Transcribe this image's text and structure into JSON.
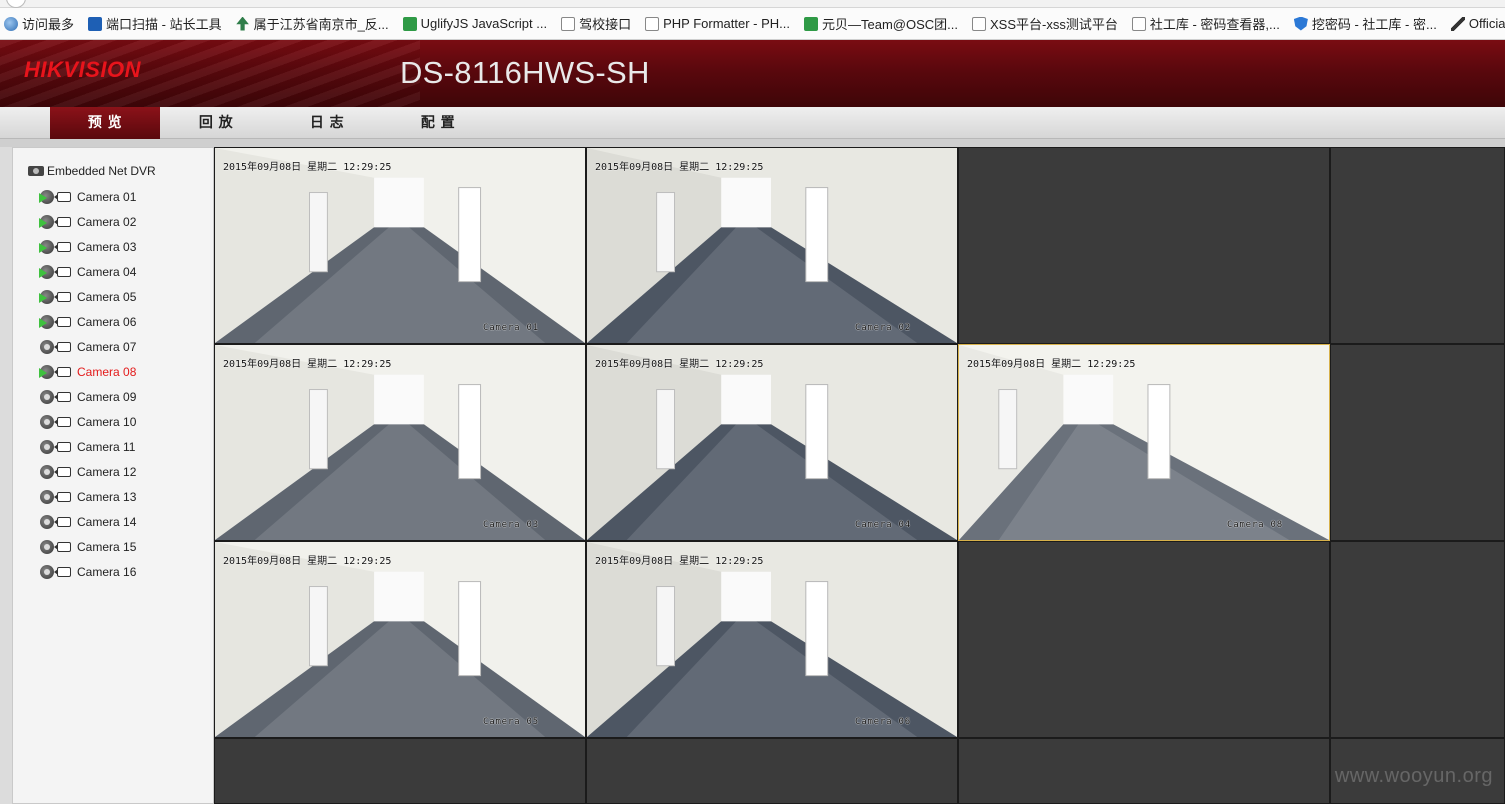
{
  "bookmarks": [
    {
      "label": "访问最多",
      "icon": "globe-icon"
    },
    {
      "label": "端口扫描 - 站长工具",
      "icon": "page-icon"
    },
    {
      "label": "属于江苏省南京市_反...",
      "icon": "tree-icon"
    },
    {
      "label": "UglifyJS JavaScript ...",
      "icon": "green-icon"
    },
    {
      "label": "驾校接口",
      "icon": "page-icon"
    },
    {
      "label": "PHP Formatter - PH...",
      "icon": "page-icon"
    },
    {
      "label": "元贝—Team@OSC团...",
      "icon": "green-icon"
    },
    {
      "label": "XSS平台-xss测试平台",
      "icon": "page-icon"
    },
    {
      "label": "社工库 - 密码查看器,...",
      "icon": "page-icon"
    },
    {
      "label": "挖密码 - 社工库 - 密...",
      "icon": "shield-icon"
    },
    {
      "label": "Official Kali Linux Do",
      "icon": "sword-icon"
    }
  ],
  "header": {
    "logo_text": "HIKVISION",
    "model": "DS-8116HWS-SH",
    "accent": "#e8141c"
  },
  "nav": {
    "items": [
      {
        "label": "预 览",
        "active": true
      },
      {
        "label": "回 放",
        "active": false
      },
      {
        "label": "日 志",
        "active": false
      },
      {
        "label": "配 置",
        "active": false
      }
    ]
  },
  "device_tree": {
    "root_label": "Embedded Net DVR",
    "selected": "Camera 08",
    "cameras": [
      {
        "label": "Camera 01",
        "live": true
      },
      {
        "label": "Camera 02",
        "live": true
      },
      {
        "label": "Camera 03",
        "live": true
      },
      {
        "label": "Camera 04",
        "live": true
      },
      {
        "label": "Camera 05",
        "live": true
      },
      {
        "label": "Camera 06",
        "live": true
      },
      {
        "label": "Camera 07",
        "live": false
      },
      {
        "label": "Camera 08",
        "live": true
      },
      {
        "label": "Camera 09",
        "live": false
      },
      {
        "label": "Camera 10",
        "live": false
      },
      {
        "label": "Camera 11",
        "live": false
      },
      {
        "label": "Camera 12",
        "live": false
      },
      {
        "label": "Camera 13",
        "live": false
      },
      {
        "label": "Camera 14",
        "live": false
      },
      {
        "label": "Camera 15",
        "live": false
      },
      {
        "label": "Camera 16",
        "live": false
      }
    ]
  },
  "tiles": [
    {
      "timestamp": "2015年09月08日  星期二  12:29:25",
      "camera": "Camera 01"
    },
    {
      "timestamp": "2015年09月08日  星期二  12:29:25",
      "camera": "Camera 02"
    },
    null,
    null,
    {
      "timestamp": "2015年09月08日  星期二  12:29:25",
      "camera": "Camera 03"
    },
    {
      "timestamp": "2015年09月08日  星期二  12:29:25",
      "camera": "Camera 04"
    },
    {
      "timestamp": "2015年09月08日  星期二  12:29:25",
      "camera": "Camera 08"
    },
    null,
    {
      "timestamp": "2015年09月08日  星期二  12:29:25",
      "camera": "Camera 05"
    },
    {
      "timestamp": "2015年09月08日  星期二  12:29:25",
      "camera": "Camera 06"
    },
    null,
    null,
    null,
    null,
    null,
    null
  ],
  "watermark": "www.wooyun.org"
}
